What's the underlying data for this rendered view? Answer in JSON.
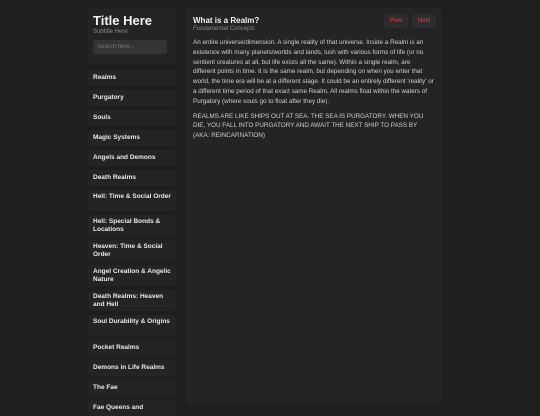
{
  "sidebar": {
    "title": "Title Here",
    "subtitle": "Subtitle Here",
    "search_placeholder": "Search here...",
    "items": [
      {
        "label": "Realms"
      },
      {
        "label": "Purgatory"
      },
      {
        "label": "Souls"
      },
      {
        "label": "Magic Systems"
      },
      {
        "label": "Angels and Demons"
      },
      {
        "label": "Death Realms"
      },
      {
        "label": "Hell: Time & Social Order"
      },
      {
        "label": "Hell: Special Bonds & Locations"
      },
      {
        "label": "Heaven: Time & Social Order"
      },
      {
        "label": "Angel Creation & Angelic Nature"
      },
      {
        "label": "Death Realms: Heaven and Hell"
      },
      {
        "label": "Soul Durability & Origins"
      },
      {
        "label": "Pocket Realms"
      },
      {
        "label": "Demons in Life Realms"
      },
      {
        "label": "The Fae"
      },
      {
        "label": "Fae Queens and"
      }
    ]
  },
  "main": {
    "title": "What is a Realm?",
    "subtitle": "Fundamental Concepts",
    "prev_label": "Prev",
    "next_label": "Next",
    "paragraphs": [
      "An entire universe/dimension. A single reality of that universe. Inside a Realm is an existence with many planets/worlds and lands, lush with various forms of life (or no sentient creatures at all, but life exists all the same). Within a single realm, are different points in time. It is the same realm, but depending on when you enter that world, the time era will be at a different stage. It could be an entirely different 'reality' or a different time period of that exact same Realm. All realms float within the waters of Purgatory (where souls go to float after they die).",
      "REALMS ARE LIKE SHIPS OUT AT SEA. THE SEA IS PURGATORY. WHEN YOU DIE, YOU FALL INTO PURGATORY AND AWAIT THE NEXT SHIP TO PASS BY (AKA: REINCARNATION)"
    ]
  }
}
